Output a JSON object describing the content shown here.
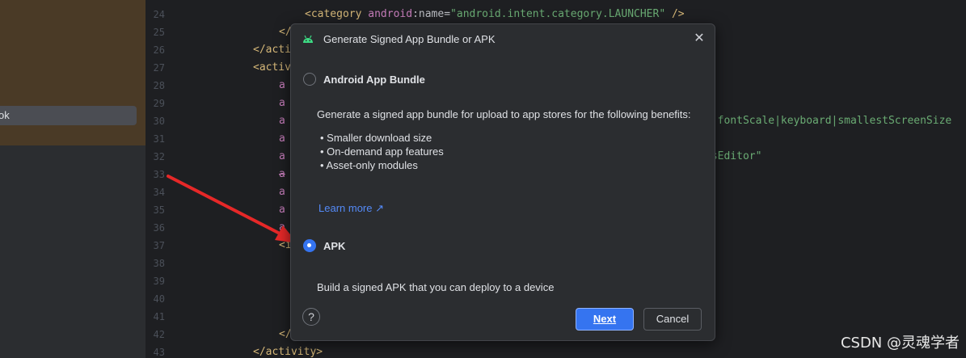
{
  "left_panel": {
    "selected_item_label": "ok"
  },
  "editor": {
    "line_numbers": [
      "24",
      "25",
      "26",
      "27",
      "28",
      "29",
      "30",
      "31",
      "32",
      "33",
      "34",
      "35",
      "36",
      "37",
      "38",
      "39",
      "40",
      "41",
      "42",
      "43"
    ],
    "line24": {
      "lt": "<",
      "tag": "category",
      "ns": "android",
      "attr": ":name=",
      "value": "\"android.intent.category.LAUNCHER\"",
      "end": " />"
    },
    "line25": "</",
    "line26": "</acti",
    "line27": "<activ",
    "short_attr": "a",
    "line37": "<i",
    "line42": "</",
    "line43": "</activity>",
    "right_text_30": "c|fontScale|keyboard|smallestScreenSize",
    "right_text_32": "nsEditor\""
  },
  "dialog": {
    "title": "Generate Signed App Bundle or APK",
    "close_glyph": "✕",
    "option_bundle": {
      "label": "Android App Bundle",
      "selected": false,
      "description": "Generate a signed app bundle for upload to app stores for the following benefits:",
      "benefits": [
        "• Smaller download size",
        "• On-demand app features",
        "• Asset-only modules"
      ],
      "learn_more": "Learn more ↗"
    },
    "option_apk": {
      "label": "APK",
      "selected": true,
      "description": "Build a signed APK that you can deploy to a device"
    },
    "help_glyph": "?",
    "next_label": "Next",
    "cancel_label": "Cancel"
  },
  "watermark": "CSDN @灵魂学者",
  "colors": {
    "accent": "#3574f0",
    "arrow": "#e62828",
    "link": "#548af7"
  }
}
